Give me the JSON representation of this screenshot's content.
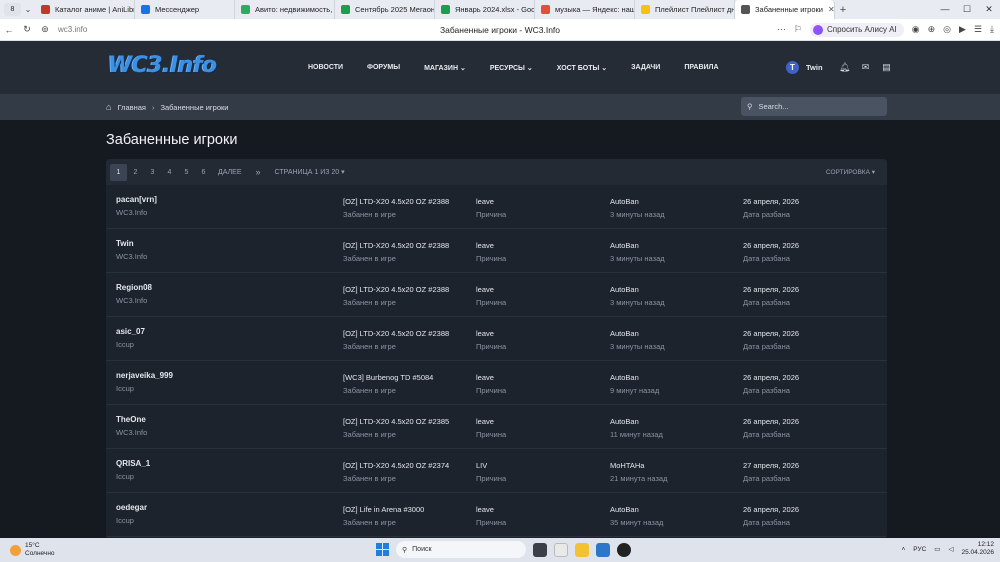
{
  "browser": {
    "tab_count": "8",
    "tabs": [
      {
        "title": "Каталог аниме | AniLibr",
        "color": "#c0392b"
      },
      {
        "title": "Мессенджер",
        "color": "#1e6ff0"
      },
      {
        "title": "Авито: недвижимость, т",
        "color": "#27ae60"
      },
      {
        "title": "Сентябрь 2025 Мегаон",
        "color": "#1e9c4f"
      },
      {
        "title": "Январь 2024.xlsx - Googl",
        "color": "#1e9c4f"
      },
      {
        "title": "музыка — Яндекс: нашл",
        "color": "#e74c3c"
      },
      {
        "title": "Плейлист Плейлист дня",
        "color": "#f1c40f"
      },
      {
        "title": "Забаненные игроки",
        "color": "#555555"
      }
    ],
    "url": "wc3.info",
    "page_title": "Забаненные игроки - WC3.Info",
    "alice_label": "Спросить Алису AI"
  },
  "site": {
    "logo": "WC3.Info",
    "nav": [
      "НОВОСТИ",
      "ФОРУМЫ",
      "МАГАЗИН",
      "РЕСУРСЫ",
      "ХОСТ БОТЫ",
      "ЗАДАЧИ",
      "ПРАВИЛА"
    ],
    "nav_dropdown": [
      false,
      false,
      true,
      true,
      true,
      false,
      false
    ],
    "user_initial": "T",
    "username": "Twin",
    "breadcrumb": {
      "home": "Главная",
      "current": "Забаненные игроки"
    },
    "search_placeholder": "Search..."
  },
  "main": {
    "title": "Забаненные игроки",
    "pagination": {
      "pages": [
        "1",
        "2",
        "3",
        "4",
        "5",
        "6"
      ],
      "current": "1",
      "next": "ДАЛЕЕ",
      "last": "»",
      "page_of": "СТРАНИЦА 1 ИЗ 20",
      "sort": "СОРТИРОВКА"
    },
    "rows": [
      {
        "player": "pacan[vrn]",
        "server": "WC3.Info",
        "game": "[OZ] LTD-X20 4.5x20 OZ #2388",
        "game_sub": "Забанен в игре",
        "reason": "leave",
        "reason_sub": "Причина",
        "admin": "AutoBan",
        "time": "3 минуты назад",
        "date": "26 апреля, 2026",
        "date_sub": "Дата разбана"
      },
      {
        "player": "Twin",
        "server": "WC3.Info",
        "game": "[OZ] LTD-X20 4.5x20 OZ #2388",
        "game_sub": "Забанен в игре",
        "reason": "leave",
        "reason_sub": "Причина",
        "admin": "AutoBan",
        "time": "3 минуты назад",
        "date": "26 апреля, 2026",
        "date_sub": "Дата разбана"
      },
      {
        "player": "Region08",
        "server": "WC3.Info",
        "game": "[OZ] LTD-X20 4.5x20 OZ #2388",
        "game_sub": "Забанен в игре",
        "reason": "leave",
        "reason_sub": "Причина",
        "admin": "AutoBan",
        "time": "3 минуты назад",
        "date": "26 апреля, 2026",
        "date_sub": "Дата разбана"
      },
      {
        "player": "asic_07",
        "server": "Iccup",
        "game": "[OZ] LTD-X20 4.5x20 OZ #2388",
        "game_sub": "Забанен в игре",
        "reason": "leave",
        "reason_sub": "Причина",
        "admin": "AutoBan",
        "time": "3 минуты назад",
        "date": "26 апреля, 2026",
        "date_sub": "Дата разбана"
      },
      {
        "player": "nerjaveika_999",
        "server": "Iccup",
        "game": "[WC3] Burbenog TD #5084",
        "game_sub": "Забанен в игре",
        "reason": "leave",
        "reason_sub": "Причина",
        "admin": "AutoBan",
        "time": "9 минут назад",
        "date": "26 апреля, 2026",
        "date_sub": "Дата разбана"
      },
      {
        "player": "TheOne",
        "server": "WC3.Info",
        "game": "[OZ] LTD-X20 4.5x20 OZ #2385",
        "game_sub": "Забанен в игре",
        "reason": "leave",
        "reason_sub": "Причина",
        "admin": "AutoBan",
        "time": "11 минут назад",
        "date": "26 апреля, 2026",
        "date_sub": "Дата разбана"
      },
      {
        "player": "QRISA_1",
        "server": "Iccup",
        "game": "[OZ] LTD-X20 4.5x20 OZ #2374",
        "game_sub": "Забанен в игре",
        "reason": "LIV",
        "reason_sub": "Причина",
        "admin": "MoHTAHa",
        "time": "21 минута назад",
        "date": "27 апреля, 2026",
        "date_sub": "Дата разбана"
      },
      {
        "player": "oedegar",
        "server": "Iccup",
        "game": "[OZ] Life in Arena #3000",
        "game_sub": "Забанен в игре",
        "reason": "leave",
        "reason_sub": "Причина",
        "admin": "AutoBan",
        "time": "35 минут назад",
        "date": "26 апреля, 2026",
        "date_sub": "Дата разбана"
      }
    ]
  },
  "taskbar": {
    "temp": "15°C",
    "weather": "Солнечно",
    "search": "Поиск",
    "lang": "РУС",
    "time": "12:12",
    "date": "25.04.2026"
  }
}
